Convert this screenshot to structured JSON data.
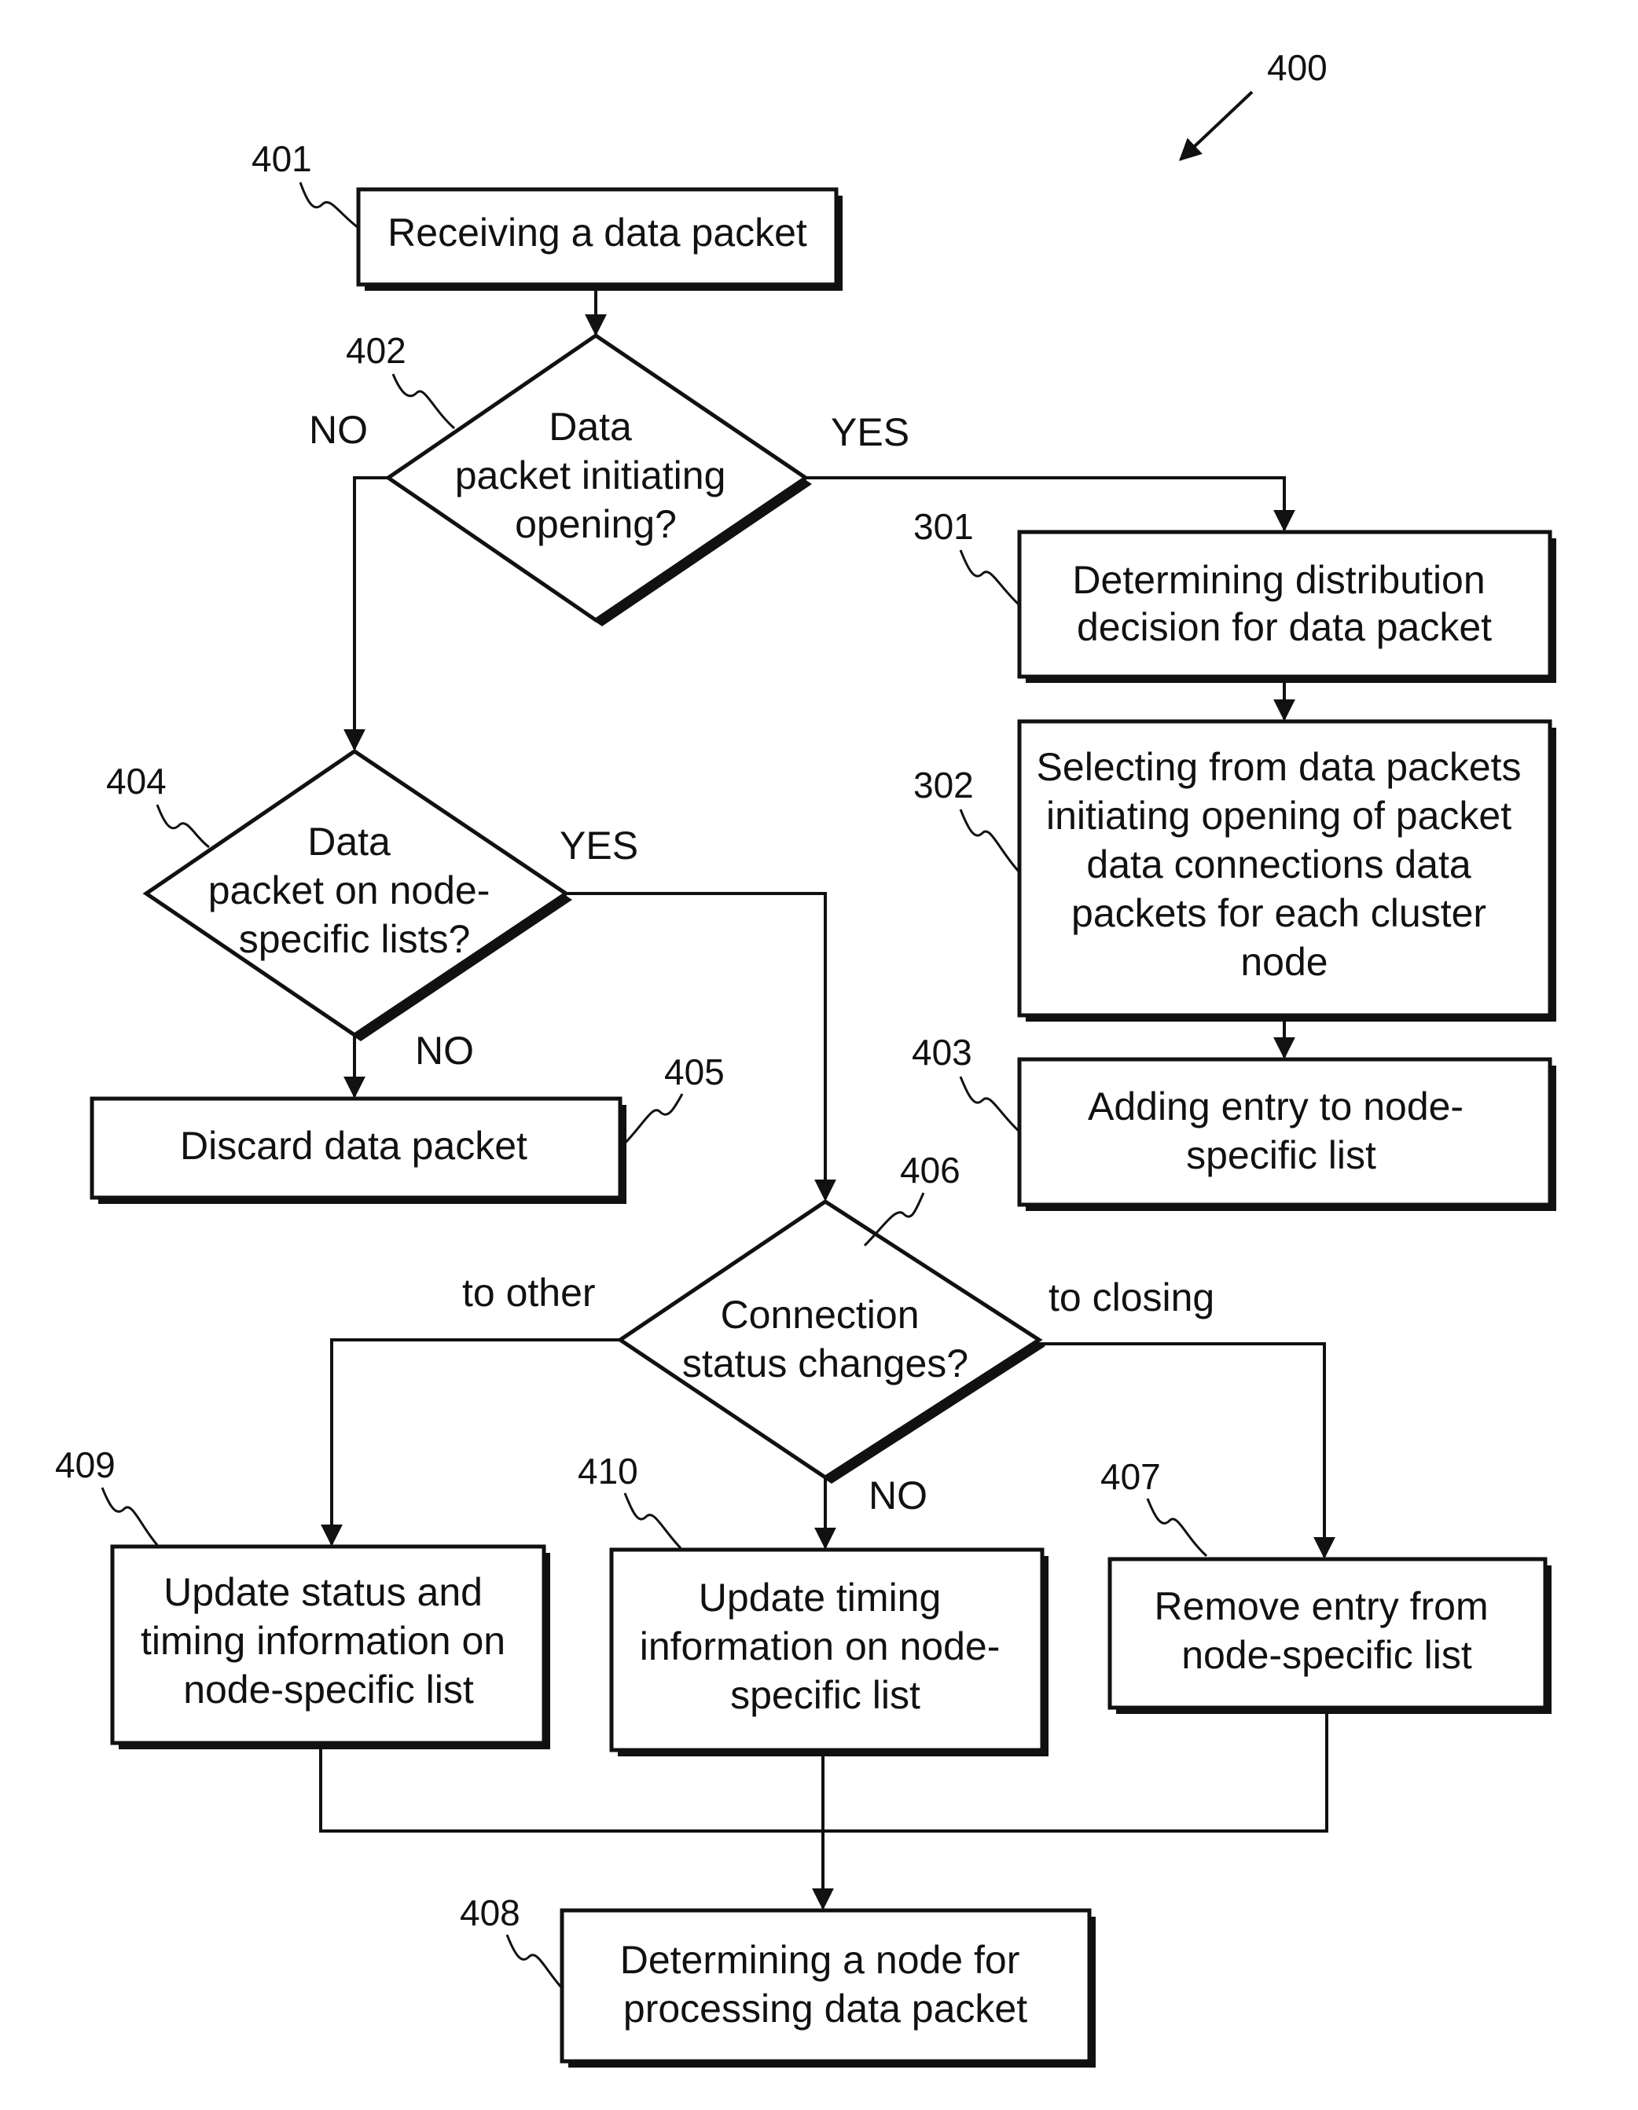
{
  "figure": {
    "ref": "400",
    "nodes": {
      "n401": {
        "ref": "401",
        "type": "process",
        "lines": [
          "Receiving a data packet"
        ]
      },
      "n402": {
        "ref": "402",
        "type": "decision",
        "lines": [
          "Data",
          "packet initiating",
          "opening?"
        ]
      },
      "n301": {
        "ref": "301",
        "type": "process",
        "lines": [
          "Determining distribution",
          "decision for data packet"
        ]
      },
      "n302": {
        "ref": "302",
        "type": "process",
        "lines": [
          "Selecting from data packets",
          "initiating opening of packet",
          "data connections data",
          "packets for each cluster",
          "node"
        ]
      },
      "n403": {
        "ref": "403",
        "type": "process",
        "lines": [
          "Adding entry to node-",
          "specific list"
        ]
      },
      "n404": {
        "ref": "404",
        "type": "decision",
        "lines": [
          "Data",
          "packet on node-",
          "specific lists?"
        ]
      },
      "n405": {
        "ref": "405",
        "type": "process",
        "lines": [
          "Discard data packet"
        ]
      },
      "n406": {
        "ref": "406",
        "type": "decision",
        "lines": [
          "Connection",
          "status changes?"
        ]
      },
      "n409": {
        "ref": "409",
        "type": "process",
        "lines": [
          "Update status and",
          "timing information on",
          "node-specific list"
        ]
      },
      "n410": {
        "ref": "410",
        "type": "process",
        "lines": [
          "Update timing",
          "information on node-",
          "specific list"
        ]
      },
      "n407": {
        "ref": "407",
        "type": "process",
        "lines": [
          "Remove entry from",
          "node-specific list"
        ]
      },
      "n408": {
        "ref": "408",
        "type": "process",
        "lines": [
          "Determining a node for",
          "processing data packet"
        ]
      }
    },
    "edge_labels": {
      "e402_no": "NO",
      "e402_yes": "YES",
      "e404_yes": "YES",
      "e404_no": "NO",
      "e406_other": "to other",
      "e406_no": "NO",
      "e406_closing": "to closing"
    }
  }
}
